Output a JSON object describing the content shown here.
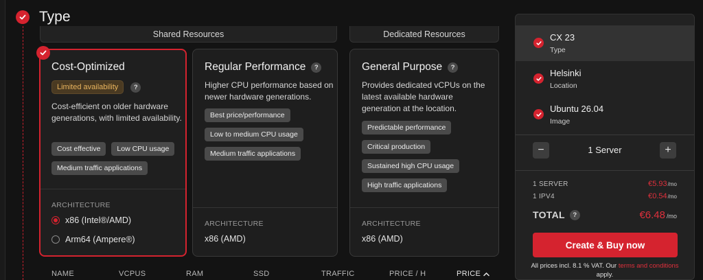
{
  "section": {
    "title": "Type"
  },
  "groups": {
    "shared": "Shared Resources",
    "dedicated": "Dedicated Resources"
  },
  "cards": [
    {
      "title": "Cost-Optimized",
      "badge": "Limited availability",
      "description": "Cost-efficient on older hardware generations, with limited availability.",
      "tags": [
        "Cost effective",
        "Low CPU usage",
        "Medium traffic applications"
      ],
      "architecture_label": "ARCHITECTURE",
      "options": [
        "x86 (Intel®/AMD)",
        "Arm64 (Ampere®)"
      ],
      "selected_option": 0
    },
    {
      "title": "Regular Performance",
      "description": "Higher CPU performance based on newer hardware generations.",
      "tags": [
        "Best price/performance",
        "Low to medium CPU usage",
        "Medium traffic applications"
      ],
      "architecture_label": "ARCHITECTURE",
      "architecture_value": "x86 (AMD)"
    },
    {
      "title": "General Purpose",
      "description": "Provides dedicated vCPUs on the latest available hardware generation at the location.",
      "tags": [
        "Predictable performance",
        "Critical production",
        "Sustained high CPU usage",
        "High traffic applications"
      ],
      "architecture_label": "ARCHITECTURE",
      "architecture_value": "x86 (AMD)"
    }
  ],
  "table_headers": [
    "NAME",
    "VCPUS",
    "RAM",
    "SSD",
    "TRAFFIC",
    "PRICE / H",
    "PRICE"
  ],
  "table_sort_icon": "chevron-up-icon",
  "summary": {
    "items": [
      {
        "title": "CX 23",
        "subtitle": "Type"
      },
      {
        "title": "Helsinki",
        "subtitle": "Location"
      },
      {
        "title": "Ubuntu 26.04",
        "subtitle": "Image"
      }
    ],
    "stepper": {
      "minus": "−",
      "plus": "+",
      "value": "1 Server"
    },
    "lines": [
      {
        "label": "1 SERVER",
        "price": "€5.93",
        "unit": "/mo"
      },
      {
        "label": "1 IPV4",
        "price": "€0.54",
        "unit": "/mo"
      }
    ],
    "total": {
      "label": "TOTAL",
      "price": "€6.48",
      "unit": "/mo"
    },
    "buy_label": "Create & Buy now",
    "vat": {
      "prefix": "All prices incl. 8.1 % VAT. Our ",
      "link": "terms and conditions",
      "suffix": " apply."
    }
  },
  "colors": {
    "accent": "#d5232f",
    "background": "#131313",
    "card": "#1e1e1e",
    "badge_text": "#e9b45e"
  }
}
